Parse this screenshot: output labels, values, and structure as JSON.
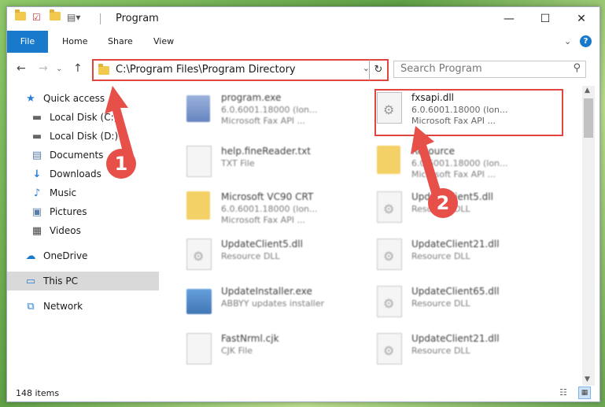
{
  "window": {
    "title": "Program",
    "controls": {
      "minimize": "—",
      "maximize": "☐",
      "close": "✕"
    }
  },
  "ribbon": {
    "tabs": [
      "File",
      "Home",
      "Share",
      "View"
    ],
    "help": "?"
  },
  "address": {
    "path": "C:\\Program Files\\Program Directory",
    "refresh": "↻",
    "dropdown": "⌄"
  },
  "search": {
    "placeholder": "Search Program"
  },
  "sidebar": {
    "items": [
      {
        "label": "Quick access",
        "icon": "★"
      },
      {
        "label": "Local Disk (C:)",
        "icon": "▬"
      },
      {
        "label": "Local Disk (D:)",
        "icon": "▬"
      },
      {
        "label": "Documents",
        "icon": "▤"
      },
      {
        "label": "Downloads",
        "icon": "↓"
      },
      {
        "label": "Music",
        "icon": "♪"
      },
      {
        "label": "Pictures",
        "icon": "▣"
      },
      {
        "label": "Videos",
        "icon": "▦"
      },
      {
        "label": "OneDrive",
        "icon": "☁"
      },
      {
        "label": "This PC",
        "icon": "▭"
      },
      {
        "label": "Network",
        "icon": "⧉"
      }
    ],
    "pin": "📌"
  },
  "files": [
    {
      "name": "program.exe",
      "line1": "6.0.6001.18000 (lon...",
      "line2": "Microsoft  Fax API ..."
    },
    {
      "name": "fxsapi.dll",
      "line1": "6.0.6001.18000 (lon...",
      "line2": "Microsoft  Fax API ..."
    },
    {
      "name": "help.fineReader.txt",
      "line1": "TXT File",
      "line2": ""
    },
    {
      "name": "Resource",
      "line1": "6.0.6001.18000 (lon...",
      "line2": "Microsoft  Fax API ..."
    },
    {
      "name": "Microsoft VC90 CRT",
      "line1": "6.0.6001.18000 (lon...",
      "line2": "Microsoft  Fax API ..."
    },
    {
      "name": "UpdateClient5.dll",
      "line1": "Resource DLL",
      "line2": ""
    },
    {
      "name": "UpdateClient5.dll",
      "line1": "Resource DLL",
      "line2": ""
    },
    {
      "name": "UpdateClient21.dll",
      "line1": "Resource DLL",
      "line2": ""
    },
    {
      "name": "UpdateInstaller.exe",
      "line1": "ABBYY updates installer",
      "line2": ""
    },
    {
      "name": "UpdateClient65.dll",
      "line1": "Resource DLL",
      "line2": ""
    },
    {
      "name": "FastNrml.cjk",
      "line1": "CJK File",
      "line2": ""
    },
    {
      "name": "UpdateClient21.dll",
      "line1": "Resource DLL",
      "line2": ""
    }
  ],
  "status": {
    "count": "148 items"
  },
  "annotations": {
    "badge1": "1",
    "badge2": "2"
  },
  "colors": {
    "accent": "#1979ca",
    "highlight": "#e0463f"
  }
}
